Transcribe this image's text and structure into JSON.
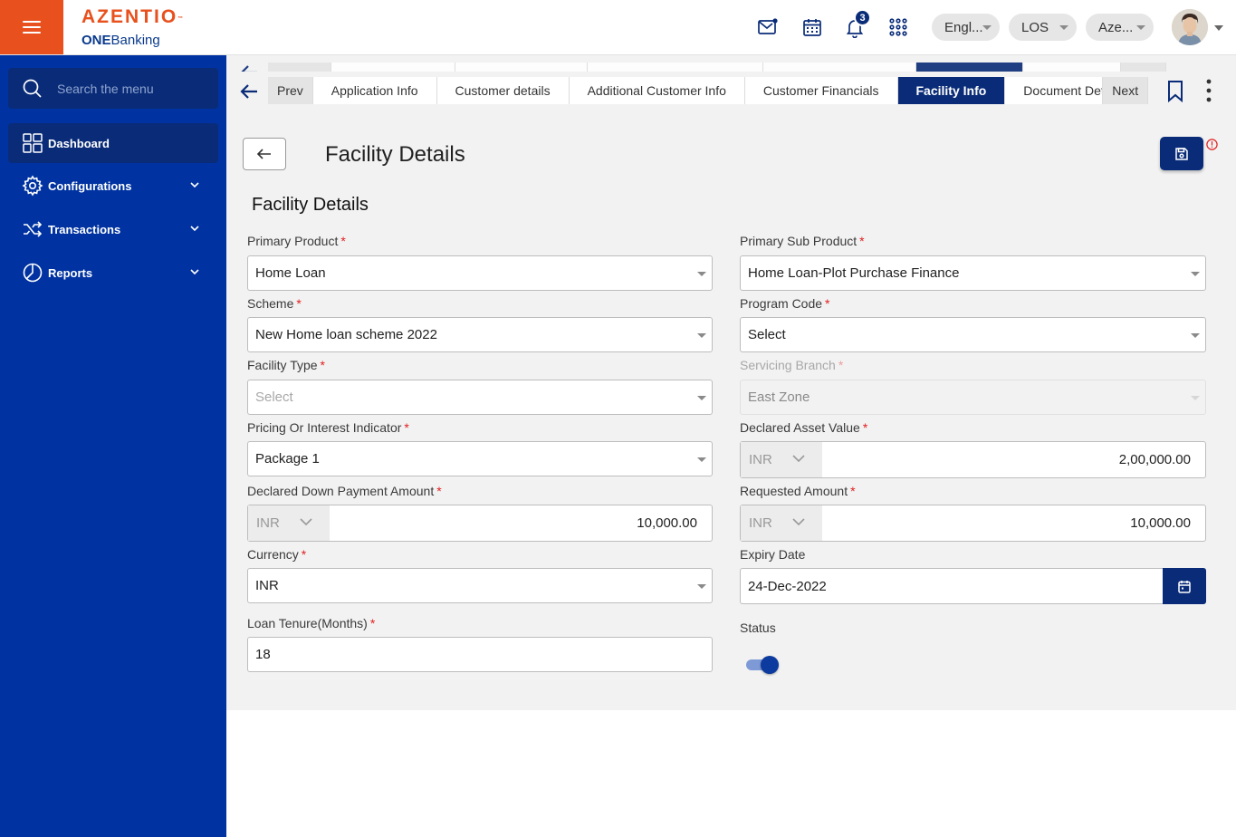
{
  "header": {
    "brand": "AZENTIO",
    "brand_mark": "™",
    "sub_bold": "ONE",
    "sub_rest": "Banking",
    "notifications_count": "3",
    "language": "Engl...",
    "module": "LOS",
    "entity": "Aze..."
  },
  "sidebar": {
    "search_placeholder": "Search the menu",
    "items": [
      {
        "label": "Dashboard",
        "icon": "grid-icon"
      },
      {
        "label": "Configurations",
        "icon": "gear-icon"
      },
      {
        "label": "Transactions",
        "icon": "shuffle-icon"
      },
      {
        "label": "Reports",
        "icon": "pie-chart-icon"
      }
    ]
  },
  "tabs": {
    "prev": "Prev",
    "next": "Next",
    "items": [
      "Application Info",
      "Customer details",
      "Additional Customer Info",
      "Customer Financials",
      "Facility Info",
      "Document Det"
    ],
    "active": "Facility Info"
  },
  "page": {
    "title": "Facility Details",
    "section_title": "Facility Details"
  },
  "form": {
    "primary_product": {
      "label": "Primary Product",
      "value": "Home Loan"
    },
    "primary_sub_product": {
      "label": "Primary Sub Product",
      "value": "Home Loan-Plot Purchase Finance"
    },
    "scheme": {
      "label": "Scheme",
      "value": "New Home loan scheme 2022"
    },
    "program_code": {
      "label": "Program Code",
      "value": "Select"
    },
    "facility_type": {
      "label": "Facility Type",
      "placeholder": "Select"
    },
    "servicing_branch": {
      "label": "Servicing Branch",
      "value": "East Zone"
    },
    "pricing_indicator": {
      "label": "Pricing Or Interest Indicator",
      "value": "Package 1"
    },
    "declared_asset_value": {
      "label": "Declared Asset Value",
      "currency": "INR",
      "amount": "2,00,000.00"
    },
    "declared_down_payment": {
      "label": "Declared Down Payment Amount",
      "currency": "INR",
      "amount": "10,000.00"
    },
    "requested_amount": {
      "label": "Requested Amount",
      "currency": "INR",
      "amount": "10,000.00"
    },
    "currency": {
      "label": "Currency",
      "value": "INR"
    },
    "expiry_date": {
      "label": "Expiry Date",
      "value": "24-Dec-2022"
    },
    "loan_tenure": {
      "label": "Loan Tenure(Months)",
      "value": "18"
    },
    "status": {
      "label": "Status",
      "enabled": true
    }
  },
  "required_mark": "*",
  "colors": {
    "brand_orange": "#e8501d",
    "sidebar_blue": "#0033a1",
    "navy": "#0a2c78",
    "required_red": "#e02020"
  }
}
